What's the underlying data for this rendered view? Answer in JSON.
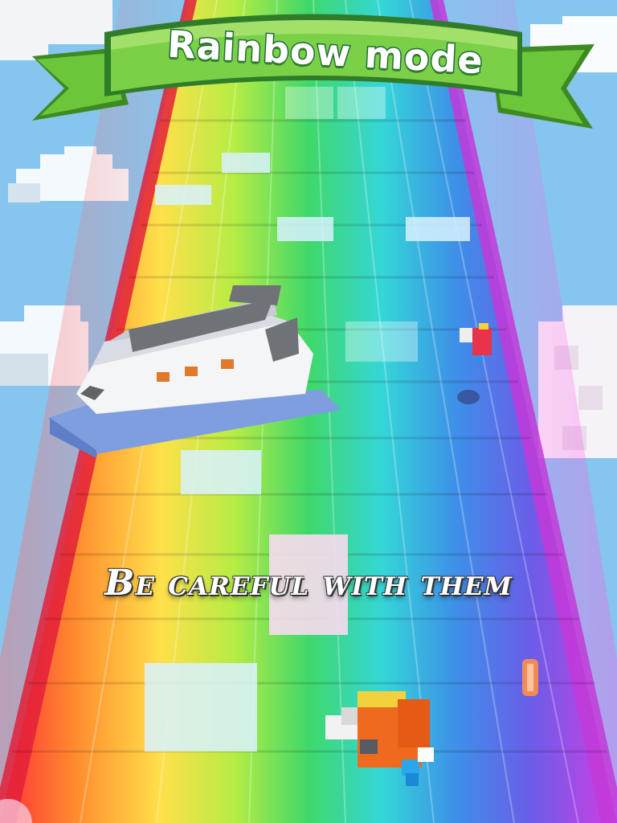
{
  "title": "Rainbow mode",
  "caption": "Be careful with them",
  "colors": {
    "sky": "#87c6ef",
    "banner_green": "#6cc63a",
    "banner_dark": "#3e8a22",
    "rainbow": [
      "#ff3b3b",
      "#ff9a2e",
      "#f7e84a",
      "#7ee04a",
      "#2fd38a",
      "#33c8e8",
      "#4a6fe0",
      "#b040e8",
      "#e040d8"
    ]
  },
  "icons": {
    "vehicle": "voxel-ship-icon",
    "player": "voxel-bird-icon",
    "enemy": "voxel-bird-icon",
    "coin": "coin-icon"
  }
}
